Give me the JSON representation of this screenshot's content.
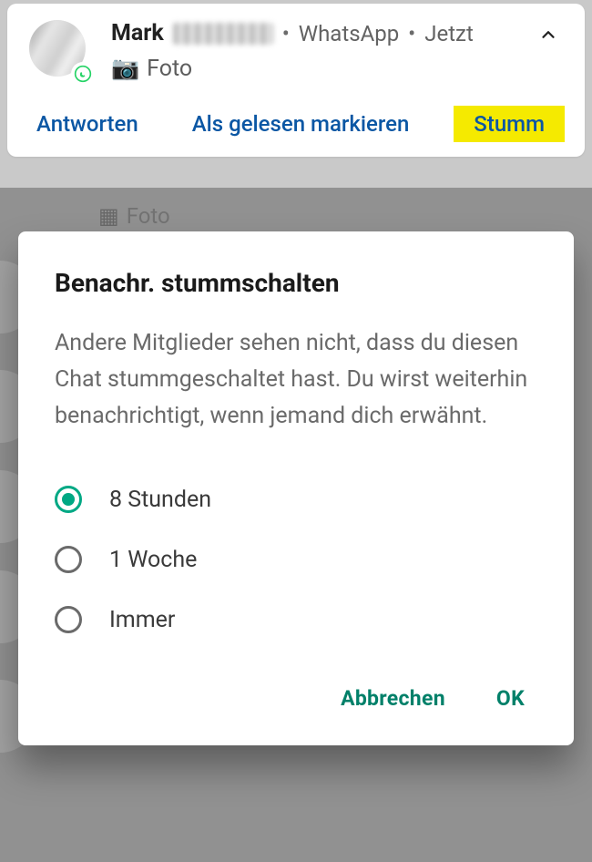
{
  "notification": {
    "sender_first_name": "Mark",
    "meta_app": "WhatsApp",
    "meta_time": "Jetzt",
    "message_icon": "camera-icon",
    "message_text": "Foto",
    "actions": {
      "reply": "Antworten",
      "mark_read": "Als gelesen markieren",
      "mute": "Stumm"
    }
  },
  "ghost_preview": "Foto",
  "dialog": {
    "title": "Benachr. stummschalten",
    "description": "Andere Mitglieder sehen nicht, dass du diesen Chat stummgeschaltet hast. Du wirst weiterhin benachrichtigt, wenn jemand dich erwähnt.",
    "options": [
      {
        "label": "8 Stunden",
        "selected": true
      },
      {
        "label": "1 Woche",
        "selected": false
      },
      {
        "label": "Immer",
        "selected": false
      }
    ],
    "actions": {
      "cancel": "Abbrechen",
      "ok": "OK"
    }
  },
  "colors": {
    "action_blue": "#0b57a4",
    "whatsapp_green": "#00a884",
    "highlight_yellow": "#f5ea00"
  }
}
